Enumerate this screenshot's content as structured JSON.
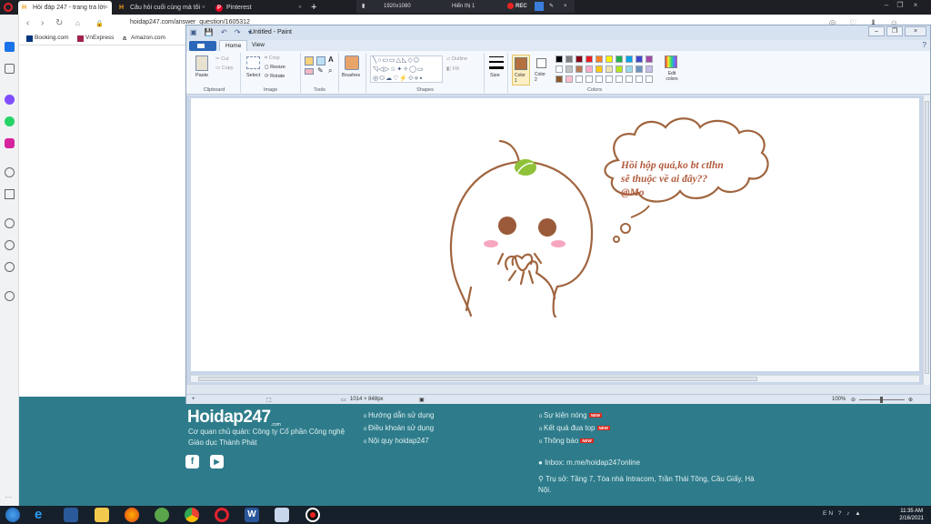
{
  "browser": {
    "tabs": [
      {
        "label": "Hỏi đáp 247 - trang tra lời",
        "favicon": "H"
      },
      {
        "label": "Câu hỏi cuối cùng mà tôi",
        "favicon": "H"
      },
      {
        "label": "Pinterest",
        "favicon": "P"
      }
    ],
    "new_tab": "+",
    "url": "hoidap247.com/answer_question/1605312",
    "bookmarks": [
      "Booking.com",
      "VnExpress",
      "Amazon.com"
    ]
  },
  "recorder": {
    "resolution": "1920x1080",
    "display": "Hiển thị 1",
    "rec_label": "REC"
  },
  "paint": {
    "title": "Untitled - Paint",
    "tabs": [
      "Home",
      "View"
    ],
    "groups": [
      "Clipboard",
      "Image",
      "Tools",
      "Shapes",
      "Colors"
    ],
    "clipboard": {
      "paste": "Paste",
      "cut": "Cut",
      "copy": "Copy"
    },
    "image": {
      "select": "Select",
      "crop": "Crop",
      "resize": "Resize",
      "rotate": "Rotate"
    },
    "brushes": "Brushes",
    "shapes": {
      "outline": "Outline",
      "fill": "Fill"
    },
    "size": "Size",
    "color1": "Color 1",
    "color2": "Color 2",
    "edit_colors": "Edit colors",
    "canvas_text": [
      "Hồi hộp quá,ko bt ctlhn",
      "sẽ thuộc về ai đây??",
      "@Mo"
    ],
    "status": {
      "dimensions": "1014 × 848px",
      "zoom": "100%"
    },
    "palette_row1": [
      "#000000",
      "#7f7f7f",
      "#880015",
      "#ed1c24",
      "#ff7f27",
      "#fff200",
      "#22b14c",
      "#00a2e8",
      "#3f48cc",
      "#a349a4"
    ],
    "palette_row2": [
      "#ffffff",
      "#c3c3c3",
      "#b97a57",
      "#ffaec9",
      "#ffc90e",
      "#efe4b0",
      "#b5e61d",
      "#99d9ea",
      "#7092be",
      "#c8bfe7"
    ],
    "palette_row3": [
      "#8b5a2b",
      "#ffc0cb",
      "#ffffff",
      "#ffffff",
      "#ffffff",
      "#ffffff",
      "#ffffff",
      "#ffffff",
      "#ffffff",
      "#ffffff"
    ],
    "accent": "#b5703f"
  },
  "footer": {
    "logo": "Hoidap247",
    "logo_sub": ".com",
    "owner_line1": "Cơ quan chủ quản: Công ty Cổ phần Công nghệ",
    "owner_line2": "Giáo dục Thành Phát",
    "links": [
      "Hướng dẫn sử dụng",
      "Điều khoản sử dụng",
      "Nội quy hoidap247"
    ],
    "links2": [
      "Sự kiện nóng",
      "Kết quả đua top",
      "Thông báo"
    ],
    "new_badge": "NEW",
    "inbox": "Inbox: m.me/hoidap247online",
    "address_line1": "Trụ sở: Tầng 7, Tòa nhà Intracom, Trần Thái Tông, Cầu Giấy, Hà",
    "address_line2": "Nội."
  },
  "taskbar": {
    "time": "11:35 AM",
    "date": "2/16/2021",
    "tray": "EN ? ♪ ▲"
  }
}
